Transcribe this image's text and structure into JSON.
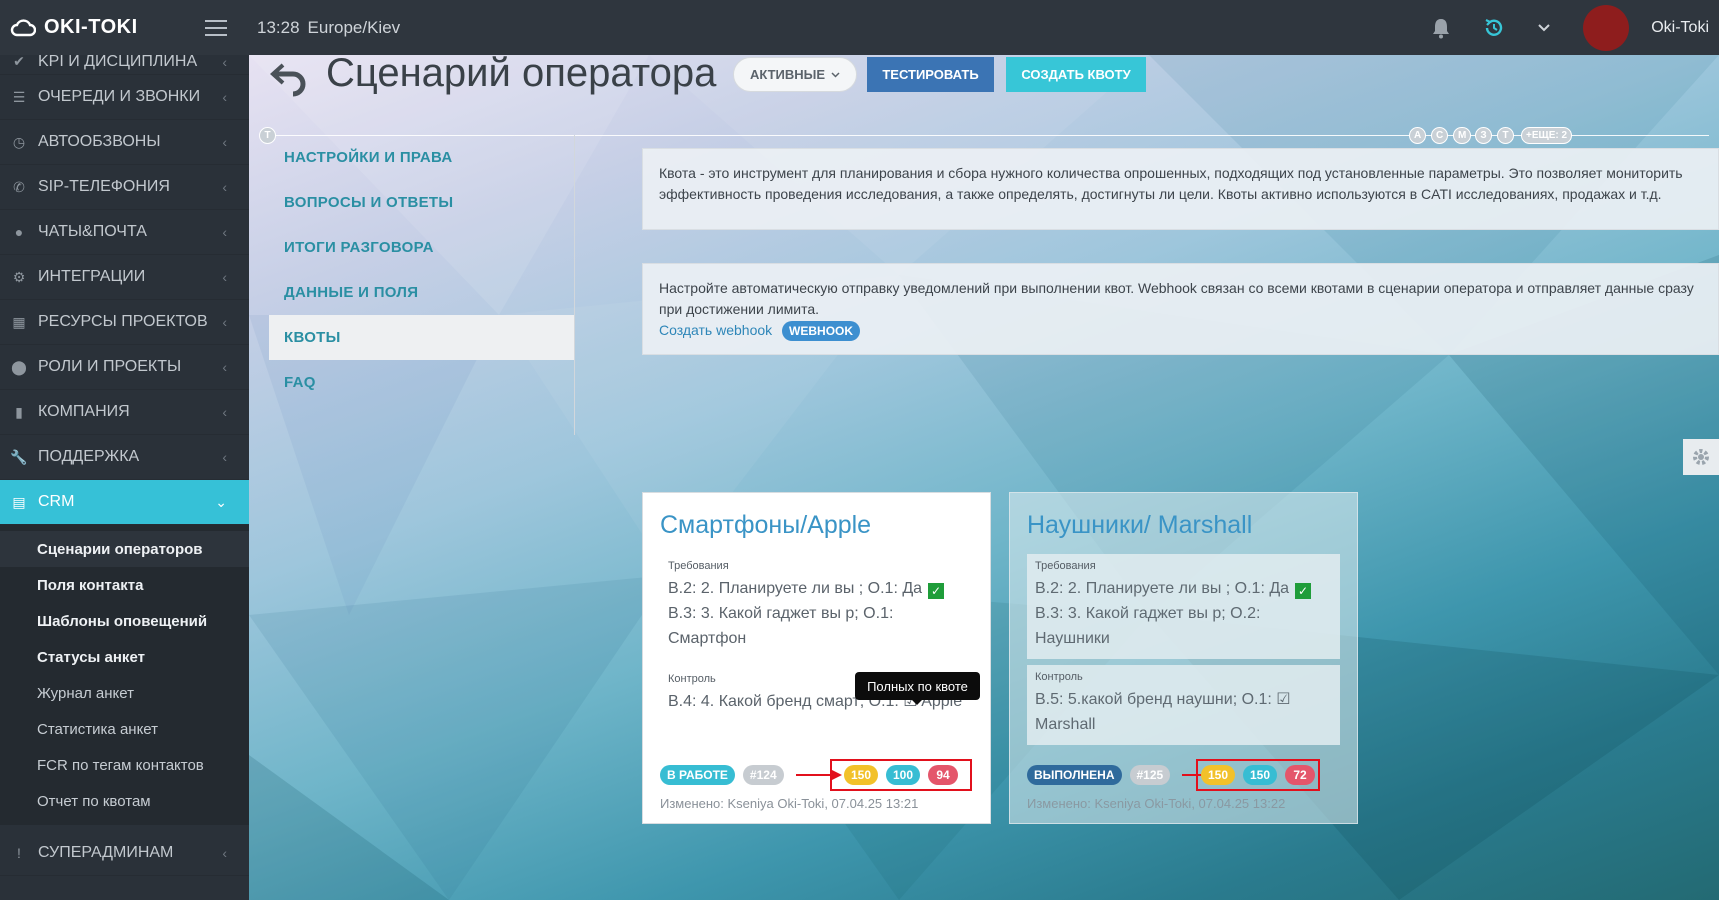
{
  "topbar": {
    "logo": "OKI-TOKI",
    "time": "13:28",
    "timezone": "Europe/Kiev",
    "user": "Oki-Toki"
  },
  "sidebar": {
    "items": [
      {
        "label": "KPI И ДИСЦИПЛИНА",
        "icon": "check-icon"
      },
      {
        "label": "ОЧЕРЕДИ И ЗВОНКИ",
        "icon": "list-icon"
      },
      {
        "label": "АВТООБЗВОНЫ",
        "icon": "clock-icon"
      },
      {
        "label": "SIP-ТЕЛЕФОНИЯ",
        "icon": "phone-icon"
      },
      {
        "label": "ЧАТЫ&ПОЧТА",
        "icon": "chat-icon"
      },
      {
        "label": "ИНТЕГРАЦИИ",
        "icon": "gears-icon"
      },
      {
        "label": "РЕСУРСЫ ПРОЕКТОВ",
        "icon": "grid-icon"
      },
      {
        "label": "РОЛИ И ПРОЕКТЫ",
        "icon": "toggle-icon"
      },
      {
        "label": "КОМПАНИЯ",
        "icon": "chart-icon"
      },
      {
        "label": "ПОДДЕРЖКА",
        "icon": "wrench-icon"
      }
    ],
    "crm": {
      "label": "CRM"
    },
    "crm_sub": [
      "Сценарии операторов",
      "Поля контакта",
      "Шаблоны оповещений",
      "Статусы анкет",
      "Журнал анкет",
      "Статистика анкет",
      "FCR по тегам контактов",
      "Отчет по квотам"
    ],
    "superadmin": {
      "label": "СУПЕРАДМИНАМ"
    }
  },
  "header": {
    "title": "Сценарий оператора",
    "filter_label": "АКТИВНЫЕ",
    "test_button": "ТЕСТИРОВАТЬ",
    "create_quota_button": "СОЗДАТЬ КВОТУ"
  },
  "timeline": {
    "start": "T",
    "dots": [
      "A",
      "C",
      "M",
      "З",
      "T"
    ],
    "more": "+ЕЩЕ: 2"
  },
  "leftnav": {
    "items": [
      "НАСТРОЙКИ И ПРАВА",
      "ВОПРОСЫ И ОТВЕТЫ",
      "ИТОГИ РАЗГОВОРА",
      "ДАННЫЕ И ПОЛЯ",
      "КВОТЫ",
      "FAQ"
    ]
  },
  "info1": {
    "text": "Квота - это инструмент для планирования и сбора нужного количества опрошенных, подходящих под установленные параметры. Это позволяет мониторить эффективность проведения исследования, а также определять, достигнуты ли цели. Квоты активно используются в CATI исследованиях, продажах и т.д."
  },
  "info2": {
    "text": "Настройте автоматическую отправку уведомлений при выполнении квот. Webhook связан со всеми квотами в сценарии оператора и отправляет данные сразу при достижении лимита.",
    "link": "Создать webhook",
    "badge": "WEBHOOK"
  },
  "tooltip": "Полных по квоте",
  "cards": [
    {
      "title": "Смартфоны/Apple",
      "req_label": "Требования",
      "req_lines": [
        "B.2: 2. Планируете ли вы ; O.1: Да",
        "B.3: 3. Какой гаджет вы р; O.1:",
        "Смартфон"
      ],
      "ctrl_label": "Контроль",
      "ctrl_lines": [
        "B.4: 4. Какой бренд смарт; O.1: ☑ Apple"
      ],
      "status": "В РАБОТЕ",
      "status_color": "#37bdd3",
      "id": "#124",
      "counts": [
        "150",
        "100",
        "94"
      ],
      "changed": "Изменено: Kseniya Oki-Toki, 07.04.25 13:21"
    },
    {
      "title": "Наушники/ Marshall",
      "req_label": "Требования",
      "req_lines": [
        "B.2: 2. Планируете ли вы ; O.1: Да",
        "B.3: 3. Какой гаджет вы р; O.2:",
        "Наушники"
      ],
      "ctrl_label": "Контроль",
      "ctrl_lines": [
        "B.5: 5.какой бренд наушни; O.1: ☑",
        "Marshall"
      ],
      "status": "ВЫПОЛНЕНА",
      "status_color": "#2f6a9c",
      "id": "#125",
      "counts": [
        "150",
        "150",
        "72"
      ],
      "changed": "Изменено: Kseniya Oki-Toki, 07.04.25 13:22"
    }
  ]
}
